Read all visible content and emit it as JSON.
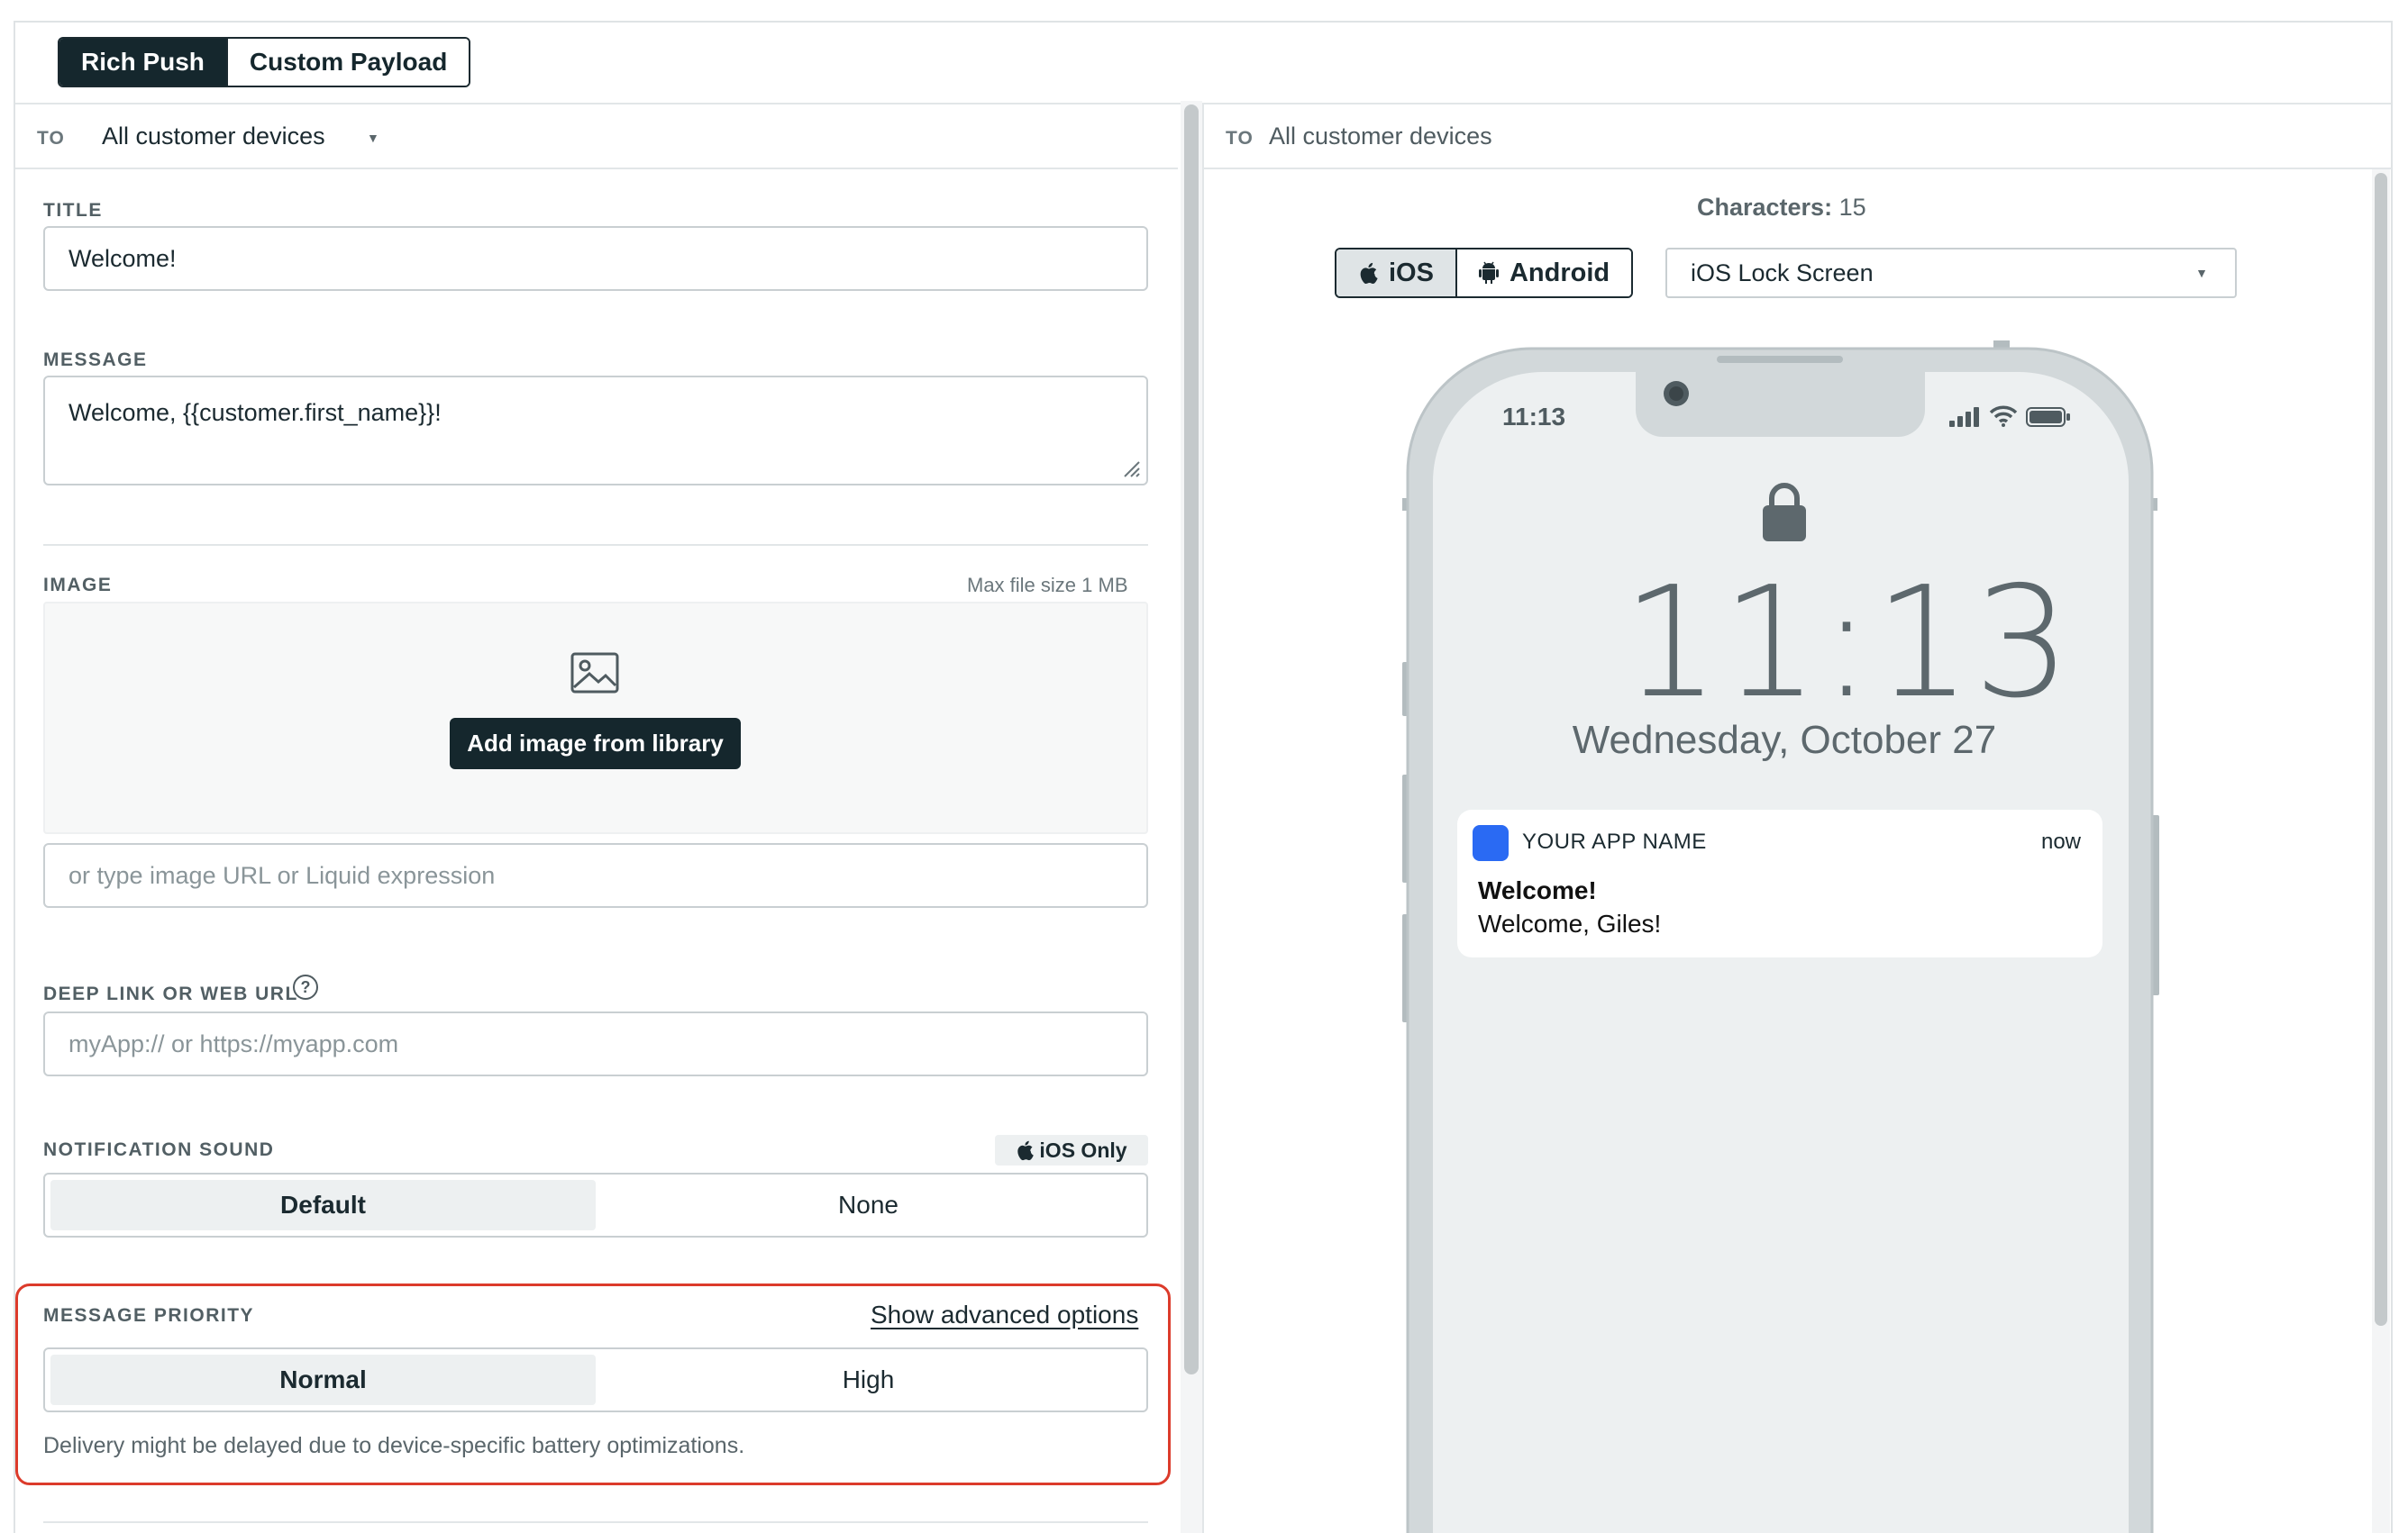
{
  "tabs": {
    "rich_push": "Rich Push",
    "custom_payload": "Custom Payload"
  },
  "left": {
    "to_label": "TO",
    "to_value": "All customer devices",
    "title_label": "TITLE",
    "title_value": "Welcome!",
    "message_label": "MESSAGE",
    "message_value": "Welcome, {{customer.first_name}}!",
    "image_label": "IMAGE",
    "image_note": "Max file size 1 MB",
    "add_image_button": "Add image from library",
    "image_url_placeholder": "or type image URL or Liquid expression",
    "deep_link_label": "DEEP LINK OR WEB URL",
    "deep_link_placeholder": "myApp:// or https://myapp.com",
    "sound_label": "NOTIFICATION SOUND",
    "ios_only": "iOS Only",
    "sound_options": [
      "Default",
      "None"
    ],
    "sound_selected": "Default",
    "priority_label": "MESSAGE PRIORITY",
    "advanced_link": "Show advanced options",
    "priority_options": [
      "Normal",
      "High"
    ],
    "priority_selected": "Normal",
    "priority_hint": "Delivery might be delayed due to device-specific battery optimizations."
  },
  "right": {
    "to_label": "TO",
    "to_value": "All customer devices",
    "characters_label": "Characters:",
    "characters_count": "15",
    "os_ios": "iOS",
    "os_android": "Android",
    "preview_select": "iOS Lock Screen",
    "phone": {
      "status_time": "11:13",
      "lock_time": "11:13",
      "date": "Wednesday, October 27",
      "notification": {
        "app_name": "YOUR APP NAME",
        "time": "now",
        "title": "Welcome!",
        "body": "Welcome, Giles!"
      }
    }
  },
  "colors": {
    "accent_dark": "#15272d",
    "highlight_border": "#dc3b2b",
    "app_icon": "#2a6af3"
  },
  "icons": [
    "image-icon",
    "help-icon",
    "apple-icon",
    "android-icon",
    "lock-icon",
    "caret-down-icon",
    "signal-icon",
    "wifi-icon",
    "battery-icon"
  ]
}
